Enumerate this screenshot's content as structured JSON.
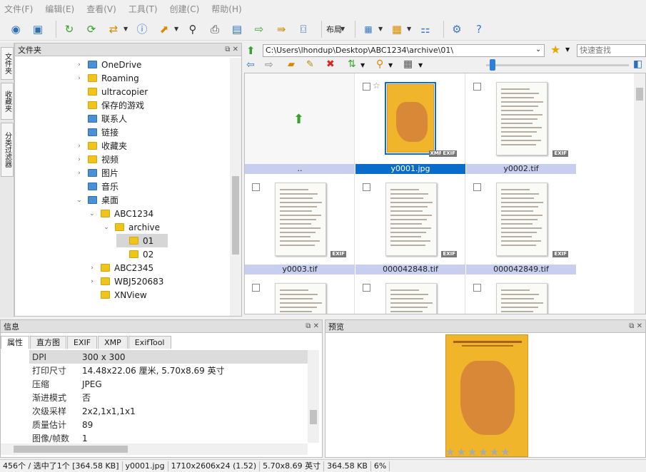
{
  "menu": [
    "文件(F)",
    "编辑(E)",
    "查看(V)",
    "工具(T)",
    "创建(C)",
    "帮助(H)"
  ],
  "toolbar": {
    "layout_label": "布局"
  },
  "left_tabs": [
    "文件夹",
    "收藏夹",
    "分类过滤器"
  ],
  "folder_panel": {
    "title": "文件夹",
    "items": [
      {
        "label": "OneDrive",
        "level": 1,
        "expander": "›",
        "icon": "blue"
      },
      {
        "label": "Roaming",
        "level": 1,
        "expander": "›",
        "icon": "yellow"
      },
      {
        "label": "ultracopier",
        "level": 1,
        "expander": "",
        "icon": "yellow"
      },
      {
        "label": "保存的游戏",
        "level": 1,
        "expander": "",
        "icon": "yellow"
      },
      {
        "label": "联系人",
        "level": 1,
        "expander": "",
        "icon": "blue"
      },
      {
        "label": "链接",
        "level": 1,
        "expander": "",
        "icon": "blue"
      },
      {
        "label": "收藏夹",
        "level": 1,
        "expander": "›",
        "icon": "yellow"
      },
      {
        "label": "视频",
        "level": 1,
        "expander": "›",
        "icon": "yellow"
      },
      {
        "label": "图片",
        "level": 1,
        "expander": "›",
        "icon": "blue"
      },
      {
        "label": "音乐",
        "level": 1,
        "expander": "",
        "icon": "blue"
      },
      {
        "label": "桌面",
        "level": 1,
        "expander": "⌄",
        "icon": "blue"
      },
      {
        "label": "ABC1234",
        "level": 2,
        "expander": "⌄",
        "icon": "yellow"
      },
      {
        "label": "archive",
        "level": 3,
        "expander": "⌄",
        "icon": "yellow"
      },
      {
        "label": "01",
        "level": 4,
        "expander": "",
        "icon": "yellow",
        "selected": true
      },
      {
        "label": "02",
        "level": 4,
        "expander": "",
        "icon": "yellow"
      },
      {
        "label": "ABC2345",
        "level": 2,
        "expander": "›",
        "icon": "yellow"
      },
      {
        "label": "WBJ520683",
        "level": 2,
        "expander": "›",
        "icon": "yellow"
      },
      {
        "label": "XNView",
        "level": 2,
        "expander": "",
        "icon": "yellow"
      }
    ]
  },
  "address": {
    "path": "C:\\Users\\lhondup\\Desktop\\ABC1234\\archive\\01\\",
    "search_placeholder": "快速查找"
  },
  "grid": {
    "items": [
      {
        "label": "..",
        "type": "parent"
      },
      {
        "label": "y0001.jpg",
        "type": "cover",
        "selected": true,
        "badges": [
          "XMP",
          "EXIF"
        ]
      },
      {
        "label": "y0002.tif",
        "type": "doc",
        "badges": [
          "EXIF"
        ]
      },
      {
        "label": "y0003.tif",
        "type": "doc",
        "badges": [
          "EXIF"
        ]
      },
      {
        "label": "000042848.tif",
        "type": "doc",
        "badges": [
          "EXIF"
        ]
      },
      {
        "label": "000042849.tif",
        "type": "doc",
        "badges": [
          "EXIF"
        ]
      },
      {
        "label": "",
        "type": "doc",
        "badges": []
      },
      {
        "label": "",
        "type": "doc",
        "badges": []
      },
      {
        "label": "",
        "type": "doc",
        "badges": []
      }
    ]
  },
  "info_panel": {
    "title": "信息",
    "tabs": [
      "属性",
      "直方图",
      "EXIF",
      "XMP",
      "ExifTool"
    ],
    "rows": [
      {
        "k": "DPI",
        "v": "300 x 300"
      },
      {
        "k": "打印尺寸",
        "v": "14.48x22.06 厘米, 5.70x8.69 英寸"
      },
      {
        "k": "压缩",
        "v": "JPEG"
      },
      {
        "k": "渐进模式",
        "v": "否"
      },
      {
        "k": "次级采样",
        "v": "2x2,1x1,1x1"
      },
      {
        "k": "质量估计",
        "v": "89"
      },
      {
        "k": "图像/帧数",
        "v": "1"
      }
    ]
  },
  "preview_panel": {
    "title": "预览"
  },
  "statusbar": [
    "456个 / 选中了1个 [364.58 KB]",
    "y0001.jpg",
    "1710x2606x24 (1.52)",
    "5.70x8.69 英寸",
    "364.58 KB",
    "6%"
  ]
}
